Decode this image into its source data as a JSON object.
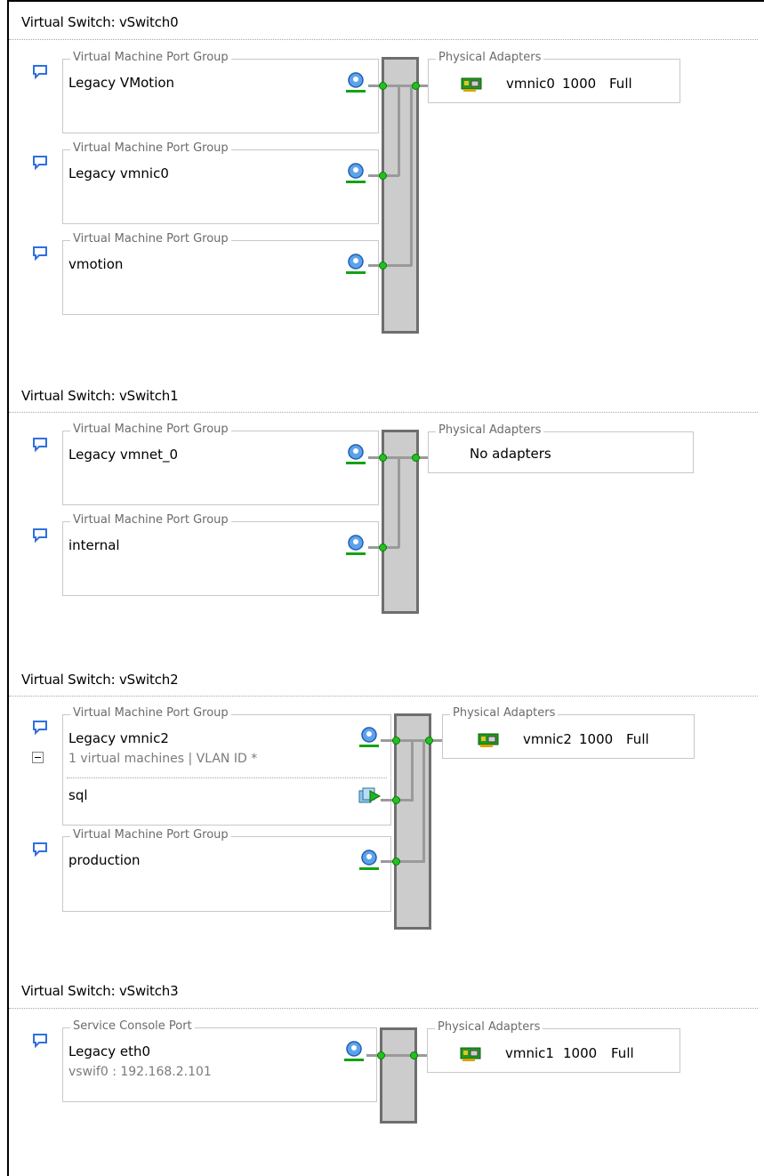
{
  "switches": [
    {
      "title": "Virtual Switch: vSwitch0",
      "port_groups": [
        {
          "legend": "Virtual Machine Port Group",
          "name": "Legacy VMotion"
        },
        {
          "legend": "Virtual Machine Port Group",
          "name": "Legacy vmnic0"
        },
        {
          "legend": "Virtual Machine Port Group",
          "name": "vmotion"
        }
      ],
      "physical": {
        "legend": "Physical Adapters",
        "name": "vmnic0",
        "speed": "1000",
        "duplex": "Full"
      }
    },
    {
      "title": "Virtual Switch: vSwitch1",
      "port_groups": [
        {
          "legend": "Virtual Machine Port Group",
          "name": "Legacy vmnet_0"
        },
        {
          "legend": "Virtual Machine Port Group",
          "name": "internal"
        }
      ],
      "physical": {
        "legend": "Physical Adapters",
        "no_adapters": "No adapters"
      }
    },
    {
      "title": "Virtual Switch: vSwitch2",
      "port_groups": [
        {
          "legend": "Virtual Machine Port Group",
          "name": "Legacy vmnic2",
          "summary": "1 virtual machines | VLAN ID *",
          "vm": "sql"
        },
        {
          "legend": "Virtual Machine Port Group",
          "name": "production"
        }
      ],
      "physical": {
        "legend": "Physical Adapters",
        "name": "vmnic2",
        "speed": "1000",
        "duplex": "Full"
      }
    },
    {
      "title": "Virtual Switch: vSwitch3",
      "port_groups": [
        {
          "legend": "Service Console Port",
          "name": "Legacy eth0",
          "summary": "vswif0 : 192.168.2.101"
        }
      ],
      "physical": {
        "legend": "Physical Adapters",
        "name": "vmnic1",
        "speed": "1000",
        "duplex": "Full"
      }
    }
  ],
  "icons": {
    "callout": "speech-bubble-icon",
    "port": "network-port-icon",
    "vm": "virtual-machine-icon",
    "nic": "network-adapter-icon"
  },
  "colors": {
    "link_dot": "#21c21c",
    "switch_fill": "#cccccc",
    "switch_border": "#6e6e6e",
    "wire": "#9a9a9a",
    "callout_blue": "#2f6fe0"
  }
}
